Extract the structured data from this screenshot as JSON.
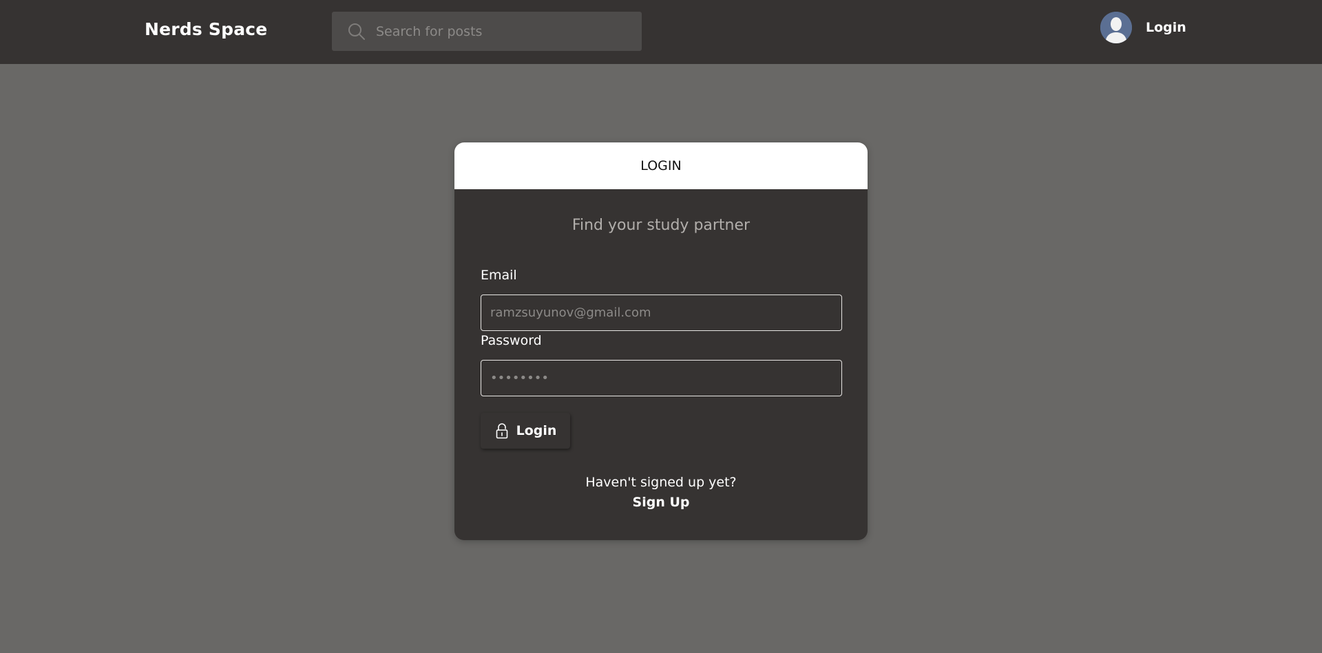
{
  "header": {
    "brand": "Nerds Space",
    "search": {
      "placeholder": "Search for posts",
      "value": ""
    },
    "user": {
      "avatar_icon": "user-avatar-icon",
      "login_label": "Login"
    }
  },
  "login_card": {
    "title": "LOGIN",
    "subtitle": "Find your study partner",
    "email": {
      "label": "Email",
      "placeholder": "ramzsuyunov@gmail.com",
      "value": ""
    },
    "password": {
      "label": "Password",
      "placeholder": "••••••••",
      "value": ""
    },
    "submit": {
      "icon": "lock-icon",
      "label": "Login"
    },
    "signup_prompt": "Haven't signed up yet?",
    "signup_link": "Sign Up"
  },
  "colors": {
    "page_background": "#696866",
    "header_background": "#363332",
    "card_background": "#363332",
    "card_header_background": "#ffffff",
    "search_background": "#4d4b4a",
    "avatar_background": "#5b6f93"
  }
}
